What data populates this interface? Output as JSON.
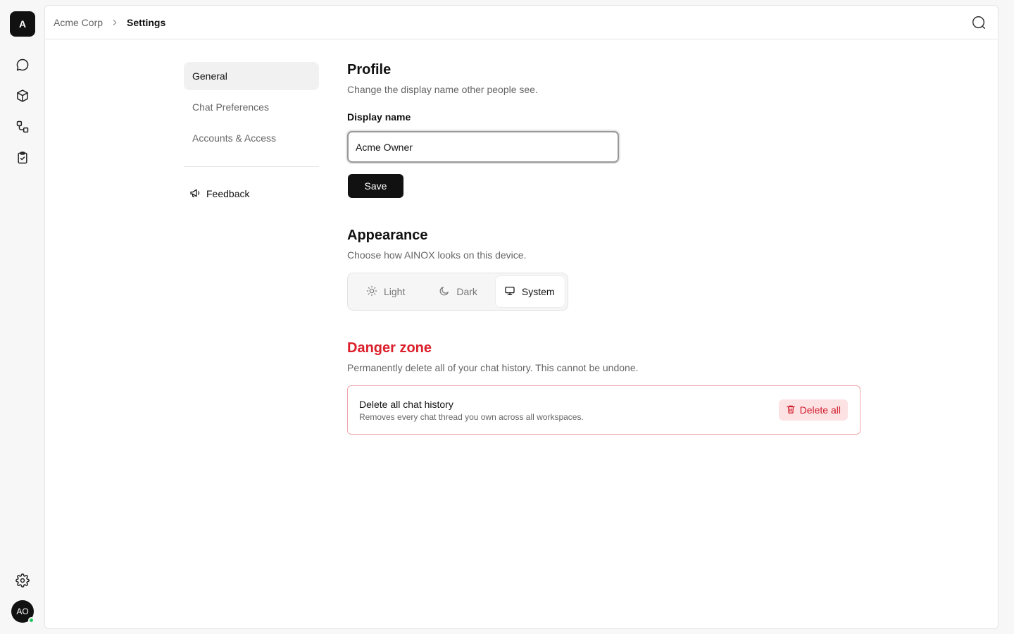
{
  "workspace": {
    "badge": "A"
  },
  "rail": {
    "icons": [
      "chat-icon",
      "cube-icon",
      "workflow-icon",
      "clipboard-check-icon"
    ],
    "bottom": {
      "settings_icon": "gear-icon",
      "avatar_initials": "AO",
      "status_color": "#22c55e"
    }
  },
  "breadcrumb": {
    "parent": "Acme Corp",
    "current": "Settings"
  },
  "settings_nav": {
    "items": [
      {
        "label": "General",
        "active": true
      },
      {
        "label": "Chat Preferences",
        "active": false
      },
      {
        "label": "Accounts & Access",
        "active": false
      }
    ],
    "feedback_label": "Feedback"
  },
  "profile": {
    "title": "Profile",
    "description": "Change the display name other people see.",
    "field_label": "Display name",
    "field_value": "Acme Owner",
    "save_label": "Save"
  },
  "appearance": {
    "title": "Appearance",
    "description": "Choose how AINOX looks on this device.",
    "options": [
      {
        "label": "Light",
        "icon": "sun-icon"
      },
      {
        "label": "Dark",
        "icon": "moon-icon"
      },
      {
        "label": "System",
        "icon": "monitor-icon",
        "selected": true
      }
    ]
  },
  "danger_zone": {
    "title": "Danger zone",
    "description": "Permanently delete all of your chat history. This cannot be undone.",
    "card_title": "Delete all chat history",
    "card_subtitle": "Removes every chat thread you own across all workspaces.",
    "button_label": "Delete all",
    "accent_color": "#dc1f2a"
  }
}
